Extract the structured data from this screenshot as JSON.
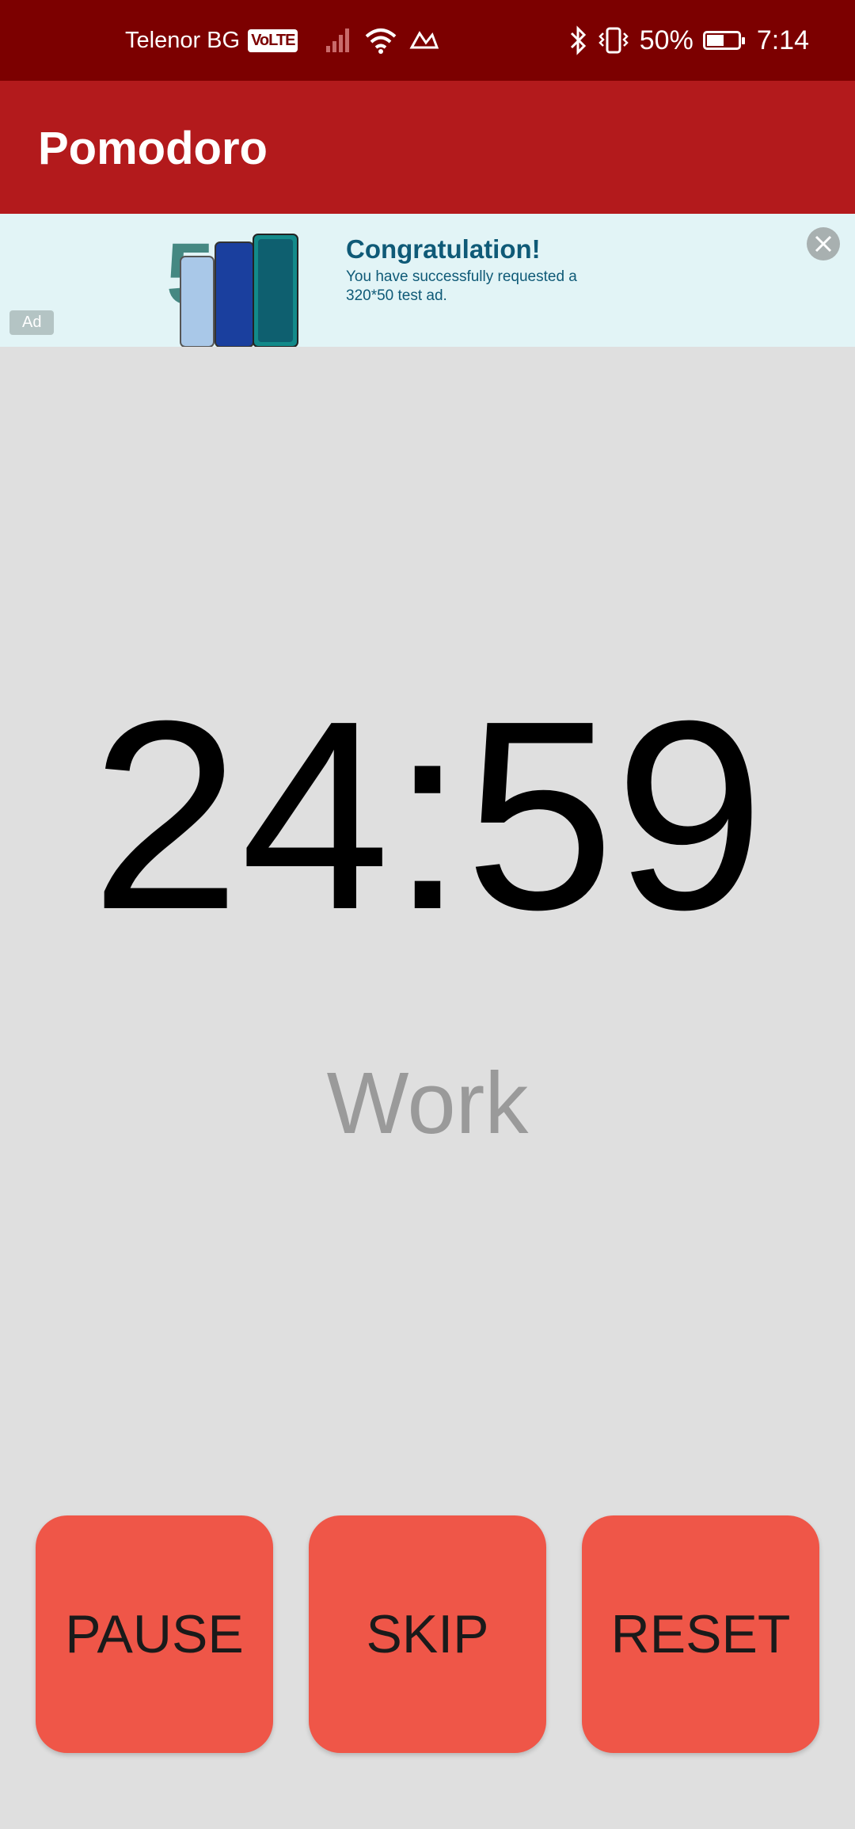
{
  "status_bar": {
    "carrier": "Telenor BG",
    "volte": "VoLTE",
    "battery_percent": "50%",
    "time": "7:14",
    "battery_level": 0.5
  },
  "app_bar": {
    "title": "Pomodoro"
  },
  "ad": {
    "title": "Congratulation!",
    "text": "You have successfully requested a 320*50 test ad.",
    "label": "Ad"
  },
  "timer": {
    "time": "24:59",
    "mode": "Work"
  },
  "buttons": {
    "pause": "PAUSE",
    "skip": "SKIP",
    "reset": "RESET"
  },
  "colors": {
    "status_bar": "#7c0000",
    "app_bar": "#b31a1c",
    "button": "#ef5648",
    "background": "#dfdfdf"
  }
}
